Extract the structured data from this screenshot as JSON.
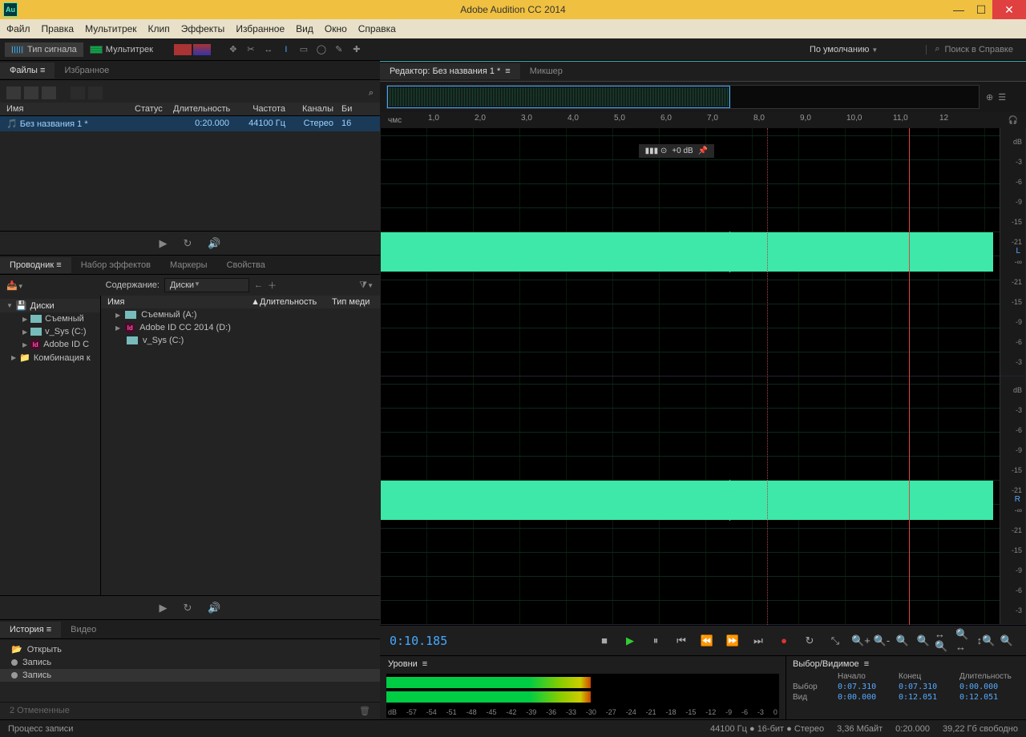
{
  "app": {
    "title": "Adobe Audition CC 2014",
    "icon_text": "Au"
  },
  "menu": [
    "Файл",
    "Правка",
    "Мультитрек",
    "Клип",
    "Эффекты",
    "Избранное",
    "Вид",
    "Окно",
    "Справка"
  ],
  "modes": {
    "waveform": "Тип сигнала",
    "multitrack": "Мультитрек"
  },
  "workspace": "По умолчанию",
  "search_placeholder": "Поиск в Справке",
  "files_panel": {
    "tab_files": "Файлы",
    "tab_fav": "Избранное",
    "cols": {
      "name": "Имя",
      "status": "Статус",
      "duration": "Длительность",
      "freq": "Частота",
      "channels": "Каналы",
      "bit": "Би"
    },
    "row": {
      "name": "Без названия 1 *",
      "duration": "0:20.000",
      "freq": "44100 Гц",
      "channels": "Стерео",
      "bit": "16"
    }
  },
  "browser": {
    "tabs": [
      "Проводник",
      "Набор эффектов",
      "Маркеры",
      "Свойства"
    ],
    "content_label": "Содержание:",
    "content_value": "Диски",
    "tree_header": "Диски",
    "tree": [
      "Съемный",
      "v_Sys (C:)",
      "Adobe ID C",
      "Комбинация к"
    ],
    "list_cols": {
      "name": "Имя",
      "duration": "Длительность",
      "type": "Тип меди"
    },
    "list": [
      "Съемный (A:)",
      "Adobe ID CC 2014 (D:)",
      "v_Sys (C:)"
    ]
  },
  "history": {
    "tabs": [
      "История",
      "Видео"
    ],
    "items": [
      "Открыть",
      "Запись",
      "Запись"
    ],
    "footer_left": "2 Отмененные"
  },
  "editor": {
    "tab_editor": "Редактор: Без названия 1 *",
    "tab_mixer": "Микшер",
    "time_label": "чмс",
    "time_ticks": [
      "1,0",
      "2,0",
      "3,0",
      "4,0",
      "5,0",
      "6,0",
      "7,0",
      "8,0",
      "9,0",
      "10,0",
      "11,0",
      "12"
    ],
    "hud": "+0 dB",
    "db_ticks": [
      "dB",
      "-3",
      "-6",
      "-9",
      "-15",
      "-21",
      "-∞",
      "-21",
      "-15",
      "-9",
      "-6",
      "-3"
    ],
    "channels": {
      "left": "L",
      "right": "R"
    }
  },
  "transport": {
    "time": "0:10.185"
  },
  "levels": {
    "title": "Уровни",
    "scale": [
      "dB",
      "-57",
      "-54",
      "-51",
      "-48",
      "-45",
      "-42",
      "-39",
      "-36",
      "-33",
      "-30",
      "-27",
      "-24",
      "-21",
      "-18",
      "-15",
      "-12",
      "-9",
      "-6",
      "-3",
      "0"
    ]
  },
  "selection": {
    "title": "Выбор/Видимое",
    "cols": [
      "Начало",
      "Конец",
      "Длительность"
    ],
    "rows": {
      "sel_label": "Выбор",
      "sel": [
        "0:07.310",
        "0:07.310",
        "0:00.000"
      ],
      "view_label": "Вид",
      "view": [
        "0:00.000",
        "0:12.051",
        "0:12.051"
      ]
    }
  },
  "status": {
    "left": "Процесс записи",
    "right": [
      "44100 Гц ● 16-бит ● Стерео",
      "3,36 Мбайт",
      "0:20.000",
      "39,22 Гб свободно"
    ]
  }
}
